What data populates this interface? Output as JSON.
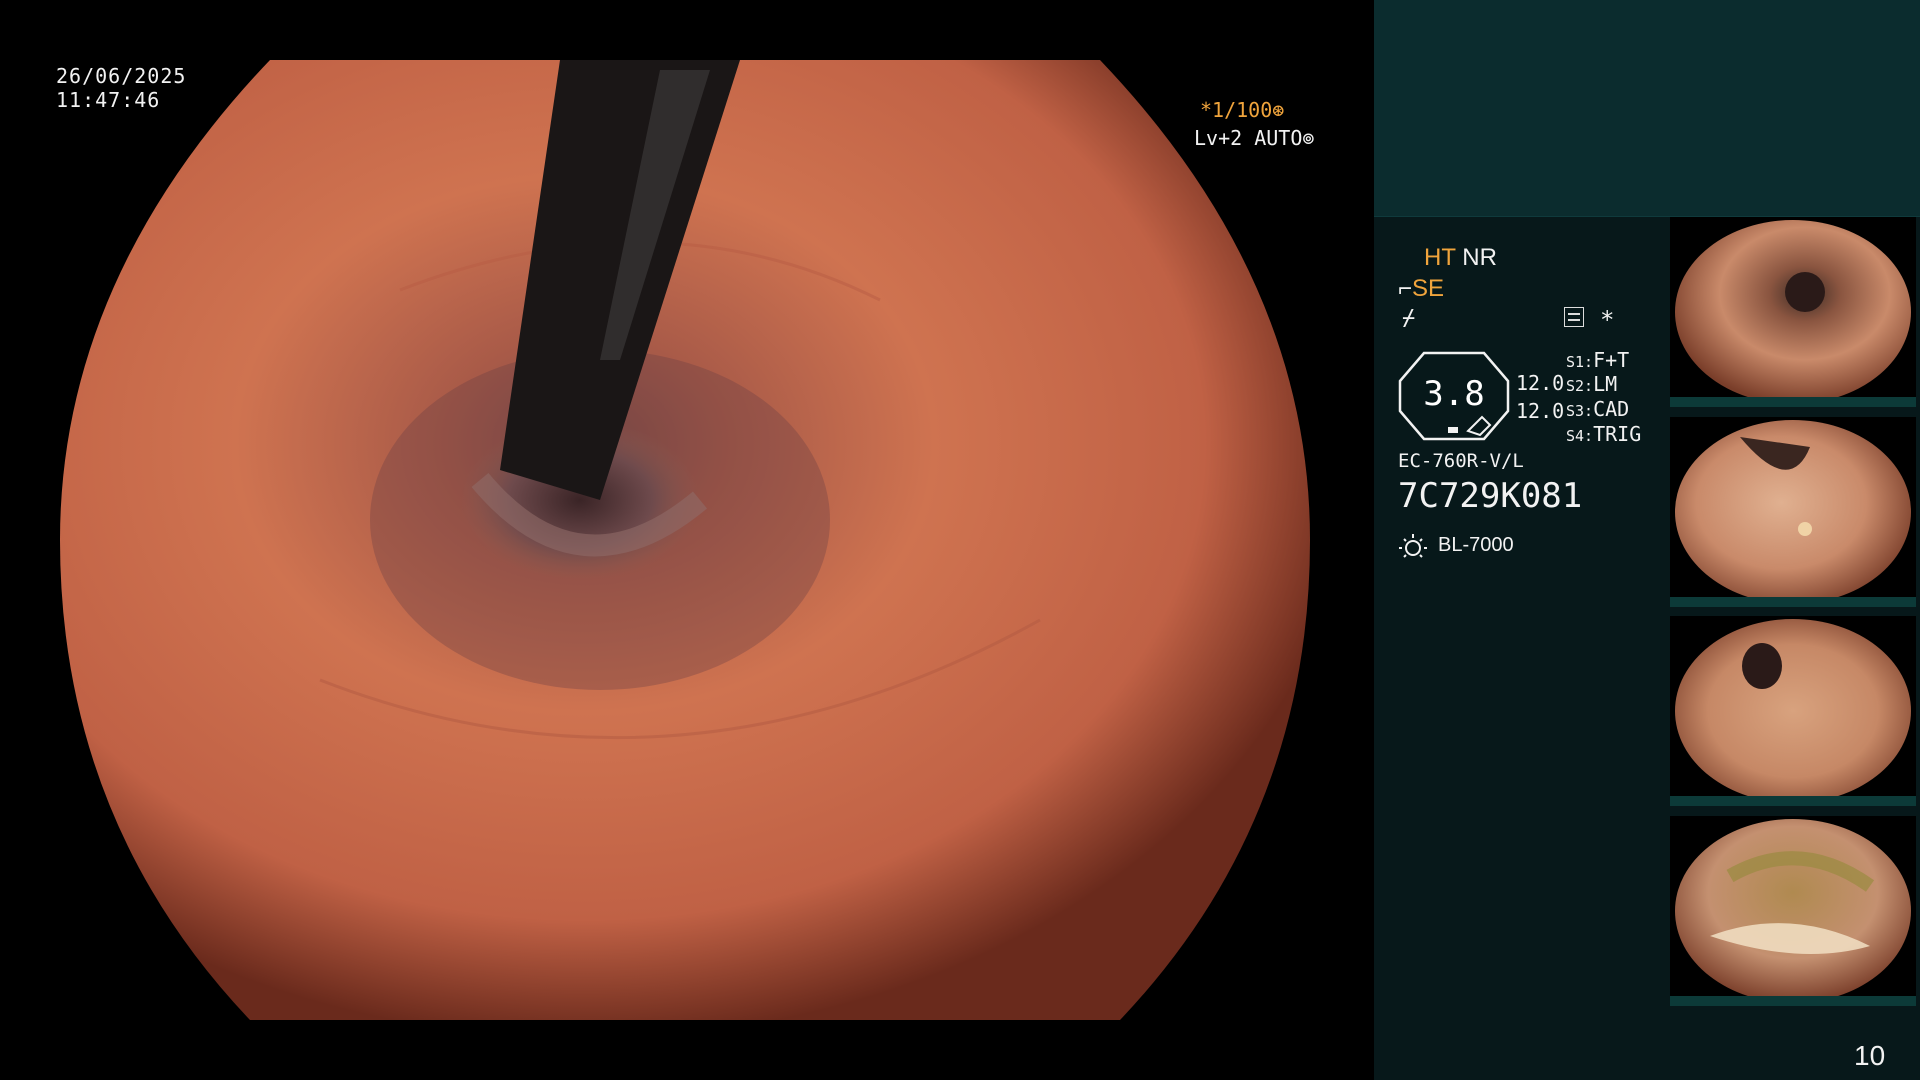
{
  "view": {
    "date": "26/06/2025",
    "time": "11:47:46",
    "shutter": "*1/100⊛",
    "iris": "Lv+2 AUTO⊚"
  },
  "panel": {
    "ht_label": "HT",
    "nr_label": "NR",
    "se_label": "SE",
    "wave_symbol": "⌿",
    "star_symbol": "*",
    "zoom_value": "3.8",
    "num_a": "12.0",
    "num_b": "12.0",
    "switches": [
      {
        "key": "S1:",
        "value": "F+T"
      },
      {
        "key": "S2:",
        "value": "LM"
      },
      {
        "key": "S3:",
        "value": "CAD"
      },
      {
        "key": "S4:",
        "value": "TRIG"
      }
    ],
    "scope_model": "EC-760R-V/L",
    "serial": "7C729K081",
    "light_source": "BL-7000",
    "page_number": "10"
  },
  "colors": {
    "panel_bg": "#07181a",
    "panel_top_bg": "#0b2c2e",
    "accent_orange": "#f0a43c",
    "mucosa": "#c8684a",
    "thumb_bar": "#0c3a38"
  }
}
